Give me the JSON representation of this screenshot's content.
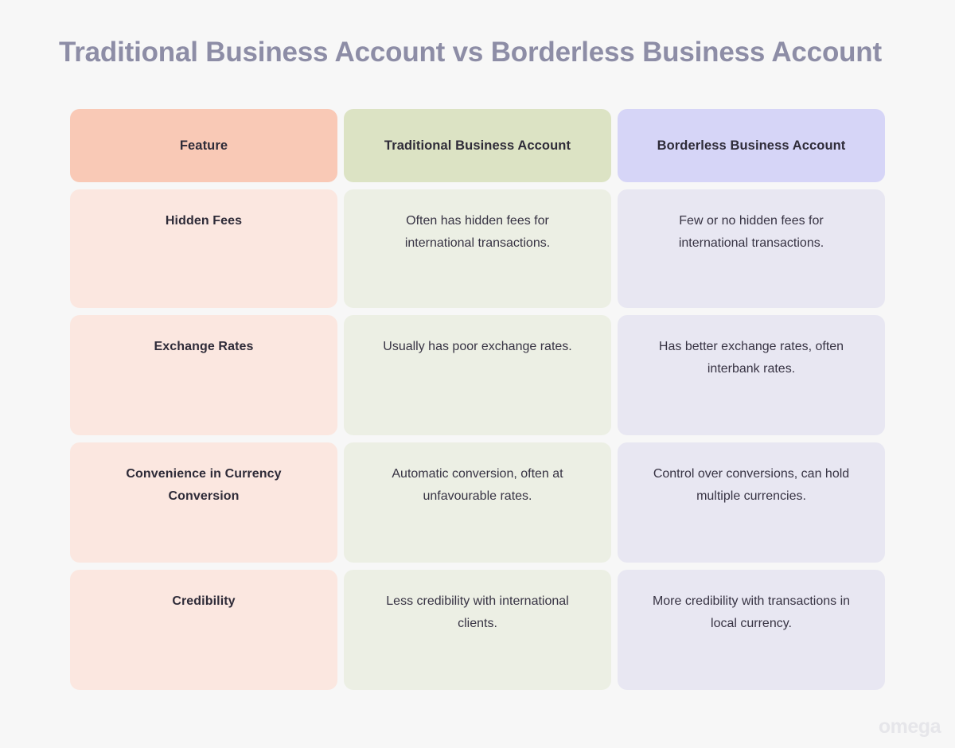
{
  "page": {
    "title": "Traditional Business Account vs Borderless Business Account",
    "background_color": "#f7f7f7",
    "title_color": "#8d8da6"
  },
  "watermark": {
    "label": "omega",
    "color": "#e6e6ea"
  },
  "theme": {
    "header_colors": [
      "#f9c9b6",
      "#dce3c4",
      "#d6d5f7"
    ],
    "body_colors": [
      "#fbe7e0",
      "#ecefe4",
      "#e8e7f2"
    ],
    "text_color": "#2e2b38"
  },
  "table": {
    "headers": [
      "Feature",
      "Traditional Business Account",
      "Borderless Business Account"
    ],
    "rows": [
      {
        "feature": "Hidden Fees",
        "traditional": "Often has hidden fees for international transactions.",
        "borderless": "Few or no hidden fees for international transactions."
      },
      {
        "feature": "Exchange Rates",
        "traditional": "Usually has poor exchange rates.",
        "borderless": "Has better exchange rates, often interbank rates."
      },
      {
        "feature": "Convenience in Currency Conversion",
        "traditional": "Automatic conversion, often at unfavourable rates.",
        "borderless": "Control over conversions, can hold multiple currencies."
      },
      {
        "feature": "Credibility",
        "traditional": "Less credibility with international clients.",
        "borderless": "More credibility with transactions in local currency."
      }
    ]
  }
}
